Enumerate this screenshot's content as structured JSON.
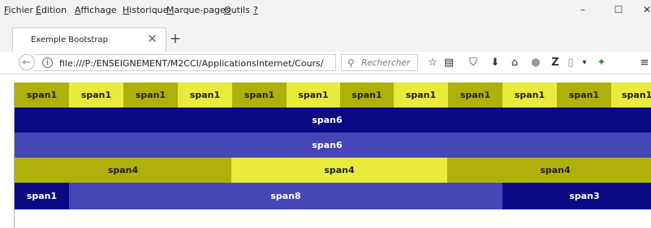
{
  "menubar": {
    "items": [
      {
        "first": "F",
        "rest": "ichier"
      },
      {
        "first": "É",
        "rest": "dition"
      },
      {
        "first": "A",
        "rest": "ffichage"
      },
      {
        "first": "H",
        "rest": "istorique"
      },
      {
        "first": "M",
        "rest": "arque-pages"
      },
      {
        "first": "O",
        "rest": "utils"
      },
      {
        "first": "?",
        "rest": ""
      }
    ],
    "minimize": "–",
    "maximize": "☐",
    "close": "✕"
  },
  "tab": {
    "title": "Exemple Bootstrap",
    "close": "✕",
    "new_tab": "+"
  },
  "navbar": {
    "back": "←",
    "info": "i",
    "url": "file:///P:/ENSEIGNEMENT/M2CCI/ApplicationsInternet/Cours/",
    "reload": "C",
    "search_placeholder": "Rechercher",
    "search_glyph": "⚲",
    "icons": [
      "☆",
      "▤",
      "⛉",
      "⬇",
      "⌂",
      "⬤",
      "Z",
      "▯",
      "▾",
      "✦",
      "≡"
    ]
  },
  "content": {
    "row1": [
      "span1",
      "span1",
      "span1",
      "span1",
      "span1",
      "span1",
      "span1",
      "span1",
      "span1",
      "span1",
      "span1",
      "span1"
    ],
    "row2": "span6",
    "row3": "span6",
    "row4": [
      "span4",
      "span4",
      "span4"
    ],
    "row5": [
      "span1",
      "span8",
      "span3"
    ]
  },
  "colors": {
    "olive": "#b0b00a",
    "yellow": "#eaea3c",
    "navy": "#0a0a85",
    "blue": "#4646b8"
  }
}
